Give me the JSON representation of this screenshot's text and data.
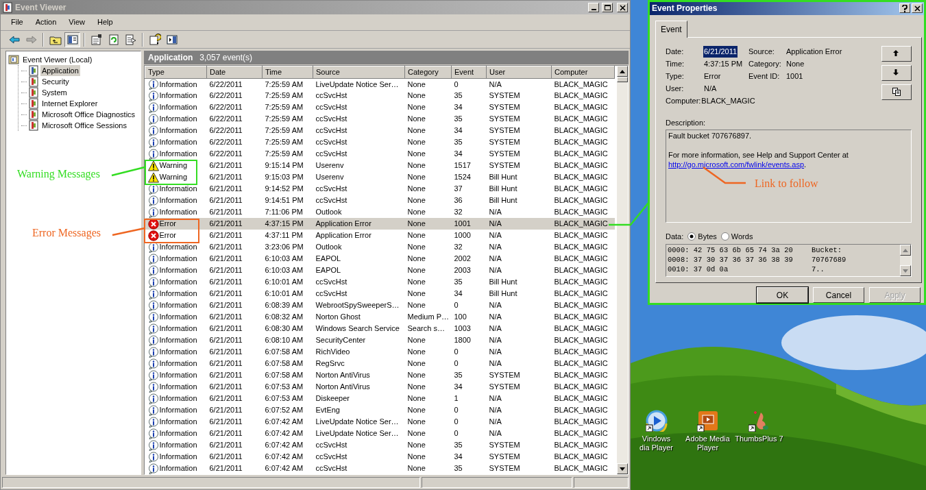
{
  "window": {
    "title": "Event Viewer"
  },
  "menu": [
    "File",
    "Action",
    "View",
    "Help"
  ],
  "toolbar": [
    {
      "disabled": false,
      "pressed": false
    },
    {
      "disabled": true,
      "pressed": false
    },
    {
      "disabled": false,
      "pressed": false
    },
    {
      "disabled": false,
      "pressed": true
    },
    {
      "disabled": false,
      "pressed": false
    },
    {
      "disabled": false,
      "pressed": false
    },
    {
      "disabled": false,
      "pressed": false
    },
    {
      "disabled": false,
      "pressed": false
    },
    {
      "disabled": false,
      "pressed": false
    }
  ],
  "tree": {
    "label": "Event Viewer (Local)",
    "children": [
      {
        "label": "Application",
        "selected": true
      },
      {
        "label": "Security",
        "selected": false
      },
      {
        "label": "System",
        "selected": false
      },
      {
        "label": "Internet Explorer",
        "selected": false
      },
      {
        "label": "Microsoft Office Diagnostics",
        "selected": false
      },
      {
        "label": "Microsoft Office Sessions",
        "selected": false
      }
    ]
  },
  "list": {
    "title": "Application",
    "count": "3,057 event(s)",
    "columns": [
      "Type",
      "Date",
      "Time",
      "Source",
      "Category",
      "Event",
      "User",
      "Computer"
    ],
    "rows": [
      {
        "kind": "information",
        "type": "Information",
        "date": "6/22/2011",
        "time": "7:25:59 AM",
        "source": "LiveUpdate Notice Ser…",
        "category": "None",
        "event": "0",
        "user": "N/A",
        "computer": "BLACK_MAGIC",
        "selected": false
      },
      {
        "kind": "information",
        "type": "Information",
        "date": "6/22/2011",
        "time": "7:25:59 AM",
        "source": "ccSvcHst",
        "category": "None",
        "event": "35",
        "user": "SYSTEM",
        "computer": "BLACK_MAGIC",
        "selected": false
      },
      {
        "kind": "information",
        "type": "Information",
        "date": "6/22/2011",
        "time": "7:25:59 AM",
        "source": "ccSvcHst",
        "category": "None",
        "event": "34",
        "user": "SYSTEM",
        "computer": "BLACK_MAGIC",
        "selected": false
      },
      {
        "kind": "information",
        "type": "Information",
        "date": "6/22/2011",
        "time": "7:25:59 AM",
        "source": "ccSvcHst",
        "category": "None",
        "event": "35",
        "user": "SYSTEM",
        "computer": "BLACK_MAGIC",
        "selected": false
      },
      {
        "kind": "information",
        "type": "Information",
        "date": "6/22/2011",
        "time": "7:25:59 AM",
        "source": "ccSvcHst",
        "category": "None",
        "event": "34",
        "user": "SYSTEM",
        "computer": "BLACK_MAGIC",
        "selected": false
      },
      {
        "kind": "information",
        "type": "Information",
        "date": "6/22/2011",
        "time": "7:25:59 AM",
        "source": "ccSvcHst",
        "category": "None",
        "event": "35",
        "user": "SYSTEM",
        "computer": "BLACK_MAGIC",
        "selected": false
      },
      {
        "kind": "information",
        "type": "Information",
        "date": "6/22/2011",
        "time": "7:25:59 AM",
        "source": "ccSvcHst",
        "category": "None",
        "event": "34",
        "user": "SYSTEM",
        "computer": "BLACK_MAGIC",
        "selected": false
      },
      {
        "kind": "warning",
        "type": "Warning",
        "date": "6/21/2011",
        "time": "9:15:14 PM",
        "source": "Userenv",
        "category": "None",
        "event": "1517",
        "user": "SYSTEM",
        "computer": "BLACK_MAGIC",
        "selected": false
      },
      {
        "kind": "warning",
        "type": "Warning",
        "date": "6/21/2011",
        "time": "9:15:03 PM",
        "source": "Userenv",
        "category": "None",
        "event": "1524",
        "user": "Bill Hunt",
        "computer": "BLACK_MAGIC",
        "selected": false
      },
      {
        "kind": "information",
        "type": "Information",
        "date": "6/21/2011",
        "time": "9:14:52 PM",
        "source": "ccSvcHst",
        "category": "None",
        "event": "37",
        "user": "Bill Hunt",
        "computer": "BLACK_MAGIC",
        "selected": false
      },
      {
        "kind": "information",
        "type": "Information",
        "date": "6/21/2011",
        "time": "9:14:51 PM",
        "source": "ccSvcHst",
        "category": "None",
        "event": "36",
        "user": "Bill Hunt",
        "computer": "BLACK_MAGIC",
        "selected": false
      },
      {
        "kind": "information",
        "type": "Information",
        "date": "6/21/2011",
        "time": "7:11:06 PM",
        "source": "Outlook",
        "category": "None",
        "event": "32",
        "user": "N/A",
        "computer": "BLACK_MAGIC",
        "selected": false
      },
      {
        "kind": "error",
        "type": "Error",
        "date": "6/21/2011",
        "time": "4:37:15 PM",
        "source": "Application Error",
        "category": "None",
        "event": "1001",
        "user": "N/A",
        "computer": "BLACK_MAGIC",
        "selected": true
      },
      {
        "kind": "error",
        "type": "Error",
        "date": "6/21/2011",
        "time": "4:37:11 PM",
        "source": "Application Error",
        "category": "None",
        "event": "1000",
        "user": "N/A",
        "computer": "BLACK_MAGIC",
        "selected": false
      },
      {
        "kind": "information",
        "type": "Information",
        "date": "6/21/2011",
        "time": "3:23:06 PM",
        "source": "Outlook",
        "category": "None",
        "event": "32",
        "user": "N/A",
        "computer": "BLACK_MAGIC",
        "selected": false
      },
      {
        "kind": "information",
        "type": "Information",
        "date": "6/21/2011",
        "time": "6:10:03 AM",
        "source": "EAPOL",
        "category": "None",
        "event": "2002",
        "user": "N/A",
        "computer": "BLACK_MAGIC",
        "selected": false
      },
      {
        "kind": "information",
        "type": "Information",
        "date": "6/21/2011",
        "time": "6:10:03 AM",
        "source": "EAPOL",
        "category": "None",
        "event": "2003",
        "user": "N/A",
        "computer": "BLACK_MAGIC",
        "selected": false
      },
      {
        "kind": "information",
        "type": "Information",
        "date": "6/21/2011",
        "time": "6:10:01 AM",
        "source": "ccSvcHst",
        "category": "None",
        "event": "35",
        "user": "Bill Hunt",
        "computer": "BLACK_MAGIC",
        "selected": false
      },
      {
        "kind": "information",
        "type": "Information",
        "date": "6/21/2011",
        "time": "6:10:01 AM",
        "source": "ccSvcHst",
        "category": "None",
        "event": "34",
        "user": "Bill Hunt",
        "computer": "BLACK_MAGIC",
        "selected": false
      },
      {
        "kind": "information",
        "type": "Information",
        "date": "6/21/2011",
        "time": "6:08:39 AM",
        "source": "WebrootSpySweeperS…",
        "category": "None",
        "event": "0",
        "user": "N/A",
        "computer": "BLACK_MAGIC",
        "selected": false
      },
      {
        "kind": "information",
        "type": "Information",
        "date": "6/21/2011",
        "time": "6:08:32 AM",
        "source": "Norton Ghost",
        "category": "Medium P…",
        "event": "100",
        "user": "N/A",
        "computer": "BLACK_MAGIC",
        "selected": false
      },
      {
        "kind": "information",
        "type": "Information",
        "date": "6/21/2011",
        "time": "6:08:30 AM",
        "source": "Windows Search Service",
        "category": "Search s…",
        "event": "1003",
        "user": "N/A",
        "computer": "BLACK_MAGIC",
        "selected": false
      },
      {
        "kind": "information",
        "type": "Information",
        "date": "6/21/2011",
        "time": "6:08:10 AM",
        "source": "SecurityCenter",
        "category": "None",
        "event": "1800",
        "user": "N/A",
        "computer": "BLACK_MAGIC",
        "selected": false
      },
      {
        "kind": "information",
        "type": "Information",
        "date": "6/21/2011",
        "time": "6:07:58 AM",
        "source": "RichVideo",
        "category": "None",
        "event": "0",
        "user": "N/A",
        "computer": "BLACK_MAGIC",
        "selected": false
      },
      {
        "kind": "information",
        "type": "Information",
        "date": "6/21/2011",
        "time": "6:07:58 AM",
        "source": "RegSrvc",
        "category": "None",
        "event": "0",
        "user": "N/A",
        "computer": "BLACK_MAGIC",
        "selected": false
      },
      {
        "kind": "information",
        "type": "Information",
        "date": "6/21/2011",
        "time": "6:07:58 AM",
        "source": "Norton AntiVirus",
        "category": "None",
        "event": "35",
        "user": "SYSTEM",
        "computer": "BLACK_MAGIC",
        "selected": false
      },
      {
        "kind": "information",
        "type": "Information",
        "date": "6/21/2011",
        "time": "6:07:53 AM",
        "source": "Norton AntiVirus",
        "category": "None",
        "event": "34",
        "user": "SYSTEM",
        "computer": "BLACK_MAGIC",
        "selected": false
      },
      {
        "kind": "information",
        "type": "Information",
        "date": "6/21/2011",
        "time": "6:07:53 AM",
        "source": "Diskeeper",
        "category": "None",
        "event": "1",
        "user": "N/A",
        "computer": "BLACK_MAGIC",
        "selected": false
      },
      {
        "kind": "information",
        "type": "Information",
        "date": "6/21/2011",
        "time": "6:07:52 AM",
        "source": "EvtEng",
        "category": "None",
        "event": "0",
        "user": "N/A",
        "computer": "BLACK_MAGIC",
        "selected": false
      },
      {
        "kind": "information",
        "type": "Information",
        "date": "6/21/2011",
        "time": "6:07:42 AM",
        "source": "LiveUpdate Notice Ser…",
        "category": "None",
        "event": "0",
        "user": "N/A",
        "computer": "BLACK_MAGIC",
        "selected": false
      },
      {
        "kind": "information",
        "type": "Information",
        "date": "6/21/2011",
        "time": "6:07:42 AM",
        "source": "LiveUpdate Notice Ser…",
        "category": "None",
        "event": "0",
        "user": "N/A",
        "computer": "BLACK_MAGIC",
        "selected": false
      },
      {
        "kind": "information",
        "type": "Information",
        "date": "6/21/2011",
        "time": "6:07:42 AM",
        "source": "ccSvcHst",
        "category": "None",
        "event": "35",
        "user": "SYSTEM",
        "computer": "BLACK_MAGIC",
        "selected": false
      },
      {
        "kind": "information",
        "type": "Information",
        "date": "6/21/2011",
        "time": "6:07:42 AM",
        "source": "ccSvcHst",
        "category": "None",
        "event": "34",
        "user": "SYSTEM",
        "computer": "BLACK_MAGIC",
        "selected": false
      },
      {
        "kind": "information",
        "type": "Information",
        "date": "6/21/2011",
        "time": "6:07:42 AM",
        "source": "ccSvcHst",
        "category": "None",
        "event": "35",
        "user": "SYSTEM",
        "computer": "BLACK_MAGIC",
        "selected": false
      }
    ]
  },
  "dialog": {
    "title": "Event Properties",
    "tabs": [
      {
        "label": "Event",
        "selected": true
      }
    ],
    "fields_left": [
      {
        "label": "Date:",
        "value": "6/21/2011",
        "highlighted": true
      },
      {
        "label": "Time:",
        "value": "4:37:15 PM",
        "highlighted": false
      },
      {
        "label": "Type:",
        "value": "Error",
        "highlighted": false
      },
      {
        "label": "User:",
        "value": "N/A",
        "highlighted": false
      },
      {
        "label": "Computer:",
        "value": "BLACK_MAGIC",
        "highlighted": false
      }
    ],
    "fields_right": [
      {
        "label": "Source:",
        "value": "Application Error"
      },
      {
        "label": "Category:",
        "value": "None"
      },
      {
        "label": "Event ID:",
        "value": "1001"
      }
    ],
    "description_label": "Description:",
    "description": [
      "Fault bucket 707676897.",
      "For more information, see Help and Support Center at"
    ],
    "link": "http://go.microsoft.com/fwlink/events.asp",
    "link_suffix": ".",
    "data_label": "Data:",
    "data_format": [
      {
        "label": "Bytes",
        "selected": true
      },
      {
        "label": "Words",
        "selected": false
      }
    ],
    "data_lines": [
      {
        "hex": "0000: 42 75 63 6b 65 74 3a 20",
        "ascii": "Bucket:"
      },
      {
        "hex": "0008: 37 30 37 36 37 36 38 39",
        "ascii": "70767689"
      },
      {
        "hex": "0010: 37 0d 0a",
        "ascii": "7.."
      }
    ],
    "buttons": [
      {
        "label": "OK",
        "disabled": false
      },
      {
        "label": "Cancel",
        "disabled": false
      },
      {
        "label": "Apply",
        "disabled": true
      }
    ]
  },
  "desktop_icons": [
    {
      "label": "Vindows\ndia Player"
    },
    {
      "label": "Adobe Media\nPlayer"
    },
    {
      "label": "ThumbsPlus 7"
    }
  ],
  "annotations": [
    {
      "text": "Warning Messages",
      "color": "#33dd22"
    },
    {
      "text": "Error Messages",
      "color": "#ee6622"
    },
    {
      "text": "Link to follow",
      "color": "#ee6622"
    }
  ]
}
